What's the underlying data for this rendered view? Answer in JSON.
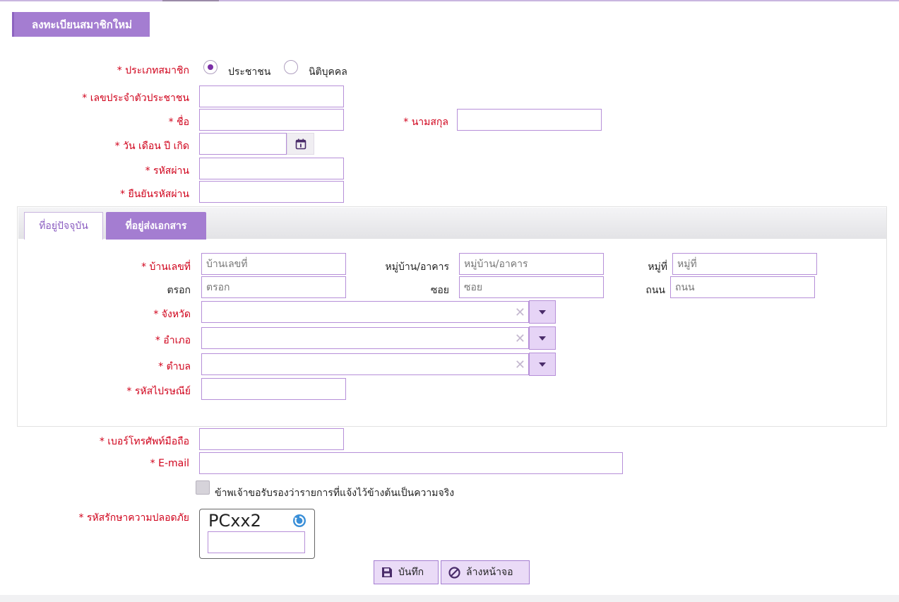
{
  "header": {
    "title": "ลงทะเบียนสมาชิกใหม่"
  },
  "member_type": {
    "label": "* ประเภทสมาชิก",
    "options": [
      "ประชาชน",
      "นิติบุคคล"
    ],
    "selected": "ประชาชน"
  },
  "fields": {
    "id_card": {
      "label": "* เลขประจำตัวประชาชน",
      "value": ""
    },
    "first_name": {
      "label": "* ชื่อ",
      "value": ""
    },
    "last_name": {
      "label": "* นามสกุล",
      "value": ""
    },
    "birth_date": {
      "label": "* วัน เดือน ปี เกิด",
      "value": ""
    },
    "password": {
      "label": "* รหัสผ่าน",
      "value": ""
    },
    "confirm_password": {
      "label": "* ยืนยันรหัสผ่าน",
      "value": ""
    }
  },
  "address_tabs": [
    "ที่อยู่ปัจจุบัน",
    "ที่อยู่ส่งเอกสาร"
  ],
  "address": {
    "house_no": {
      "label": "* บ้านเลขที่",
      "placeholder": "บ้านเลขที่"
    },
    "village": {
      "label": "หมู่บ้าน/อาคาร",
      "placeholder": "หมู่บ้าน/อาคาร"
    },
    "moo": {
      "label": "หมู่ที่",
      "placeholder": "หมู่ที่"
    },
    "alley": {
      "label": "ตรอก",
      "placeholder": "ตรอก"
    },
    "soi": {
      "label": "ซอย",
      "placeholder": "ซอย"
    },
    "road": {
      "label": "ถนน",
      "placeholder": "ถนน"
    },
    "province": {
      "label": "* จังหวัด",
      "value": ""
    },
    "district": {
      "label": "* อำเภอ",
      "value": ""
    },
    "subdistrict": {
      "label": "* ตำบล",
      "value": ""
    },
    "postcode": {
      "label": "* รหัสไปรษณีย์",
      "value": ""
    }
  },
  "contact": {
    "mobile": {
      "label": "* เบอร์โทรศัพท์มือถือ",
      "value": ""
    },
    "email": {
      "label": "* E-mail",
      "value": ""
    }
  },
  "certify_text": "ข้าพเจ้าขอรับรองว่ารายการที่แจ้งไว้ข้างต้นเป็นความจริง",
  "captcha": {
    "label": "* รหัสรักษาความปลอดภัย",
    "code": "PCxx2",
    "value": ""
  },
  "buttons": {
    "save": "บันทึก",
    "clear": "ล้างหน้าจอ"
  },
  "colors": {
    "accent": "#a47dd1",
    "required": "#d0021b",
    "border": "#b68fd8"
  }
}
